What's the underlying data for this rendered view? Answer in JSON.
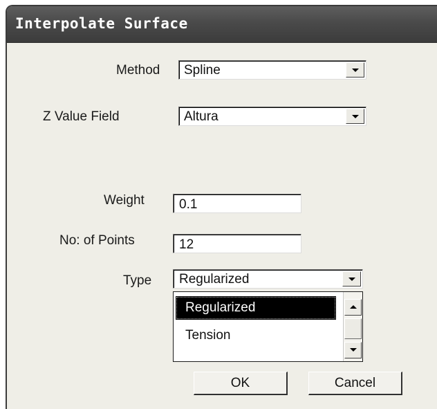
{
  "window": {
    "title": "Interpolate Surface"
  },
  "method": {
    "label": "Method",
    "value": "Spline"
  },
  "z_value_field": {
    "label": "Z Value Field",
    "value": "Altura"
  },
  "weight": {
    "label": "Weight",
    "value": "0.1"
  },
  "points": {
    "label": "No: of Points",
    "value": "12"
  },
  "type": {
    "label": "Type",
    "value": "Regularized",
    "options": [
      "Regularized",
      "Tension"
    ],
    "selected_index": 0
  },
  "buttons": {
    "ok": "OK",
    "cancel": "Cancel"
  },
  "colors": {
    "titlebar": "#4a4a4a",
    "dialog_bg": "#efeee7",
    "selection": "#000000"
  }
}
